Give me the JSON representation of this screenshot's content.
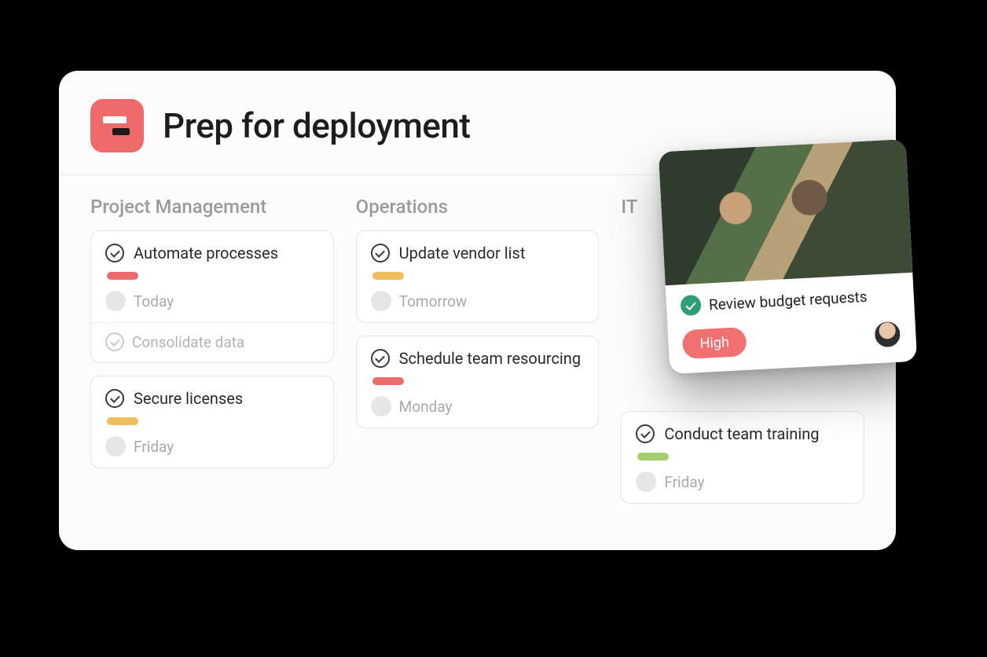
{
  "project": {
    "title": "Prep for deployment"
  },
  "columns": [
    {
      "title": "Project Management",
      "cards": [
        {
          "title": "Automate processes",
          "tag_color": "red",
          "due": "Today",
          "subtask": "Consolidate data"
        },
        {
          "title": "Secure licenses",
          "tag_color": "yellow",
          "due": "Friday"
        }
      ]
    },
    {
      "title": "Operations",
      "cards": [
        {
          "title": "Update vendor list",
          "tag_color": "yellow",
          "due": "Tomorrow"
        },
        {
          "title": "Schedule team resourcing",
          "tag_color": "red",
          "due": "Monday"
        }
      ]
    },
    {
      "title": "IT",
      "cards": [
        {
          "title": "Conduct team training",
          "tag_color": "green",
          "due": "Friday"
        }
      ]
    }
  ],
  "detail": {
    "title": "Review budget requests",
    "priority": "High"
  },
  "colors": {
    "red": "#ee6b6b",
    "yellow": "#f1bd5d",
    "green": "#a5ce6c",
    "accent": "#ef6a6a",
    "success": "#2f9e77"
  }
}
